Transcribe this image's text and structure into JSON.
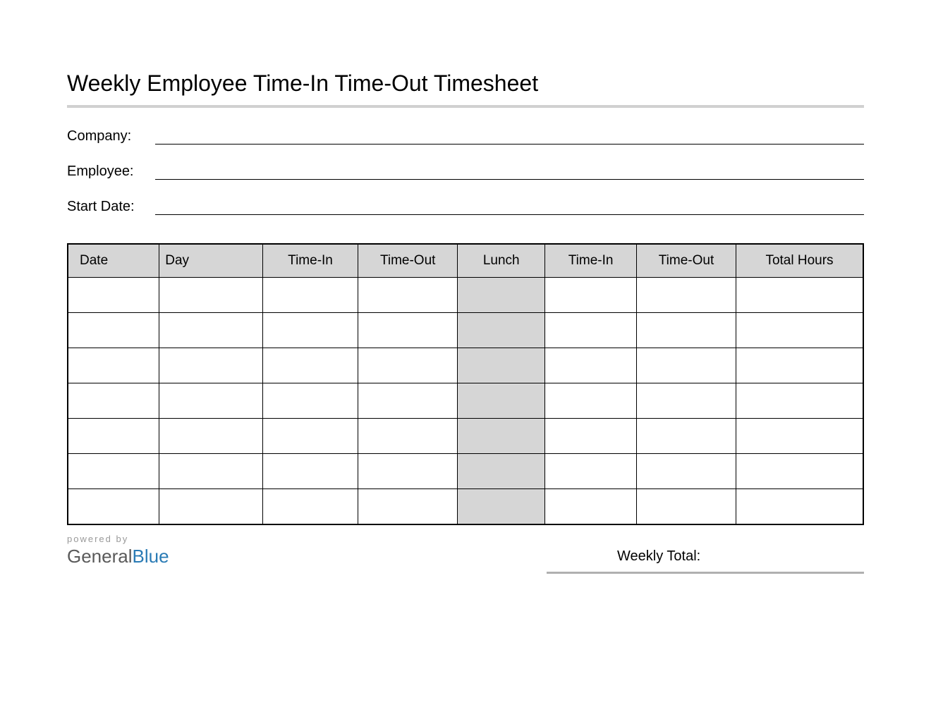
{
  "title": "Weekly Employee Time-In Time-Out Timesheet",
  "info_fields": {
    "company_label": "Company:",
    "company_value": "",
    "employee_label": "Employee:",
    "employee_value": "",
    "start_date_label": "Start Date:",
    "start_date_value": ""
  },
  "table": {
    "headers": {
      "date": "Date",
      "day": "Day",
      "time_in_1": "Time-In",
      "time_out_1": "Time-Out",
      "lunch": "Lunch",
      "time_in_2": "Time-In",
      "time_out_2": "Time-Out",
      "total_hours": "Total Hours"
    },
    "rows": [
      {
        "date": "",
        "day": "",
        "time_in_1": "",
        "time_out_1": "",
        "lunch": "",
        "time_in_2": "",
        "time_out_2": "",
        "total_hours": ""
      },
      {
        "date": "",
        "day": "",
        "time_in_1": "",
        "time_out_1": "",
        "lunch": "",
        "time_in_2": "",
        "time_out_2": "",
        "total_hours": ""
      },
      {
        "date": "",
        "day": "",
        "time_in_1": "",
        "time_out_1": "",
        "lunch": "",
        "time_in_2": "",
        "time_out_2": "",
        "total_hours": ""
      },
      {
        "date": "",
        "day": "",
        "time_in_1": "",
        "time_out_1": "",
        "lunch": "",
        "time_in_2": "",
        "time_out_2": "",
        "total_hours": ""
      },
      {
        "date": "",
        "day": "",
        "time_in_1": "",
        "time_out_1": "",
        "lunch": "",
        "time_in_2": "",
        "time_out_2": "",
        "total_hours": ""
      },
      {
        "date": "",
        "day": "",
        "time_in_1": "",
        "time_out_1": "",
        "lunch": "",
        "time_in_2": "",
        "time_out_2": "",
        "total_hours": ""
      },
      {
        "date": "",
        "day": "",
        "time_in_1": "",
        "time_out_1": "",
        "lunch": "",
        "time_in_2": "",
        "time_out_2": "",
        "total_hours": ""
      }
    ]
  },
  "footer": {
    "powered_by": "powered by",
    "logo_part1": "General",
    "logo_part2": "Blue",
    "weekly_total_label": "Weekly Total:",
    "weekly_total_value": ""
  }
}
